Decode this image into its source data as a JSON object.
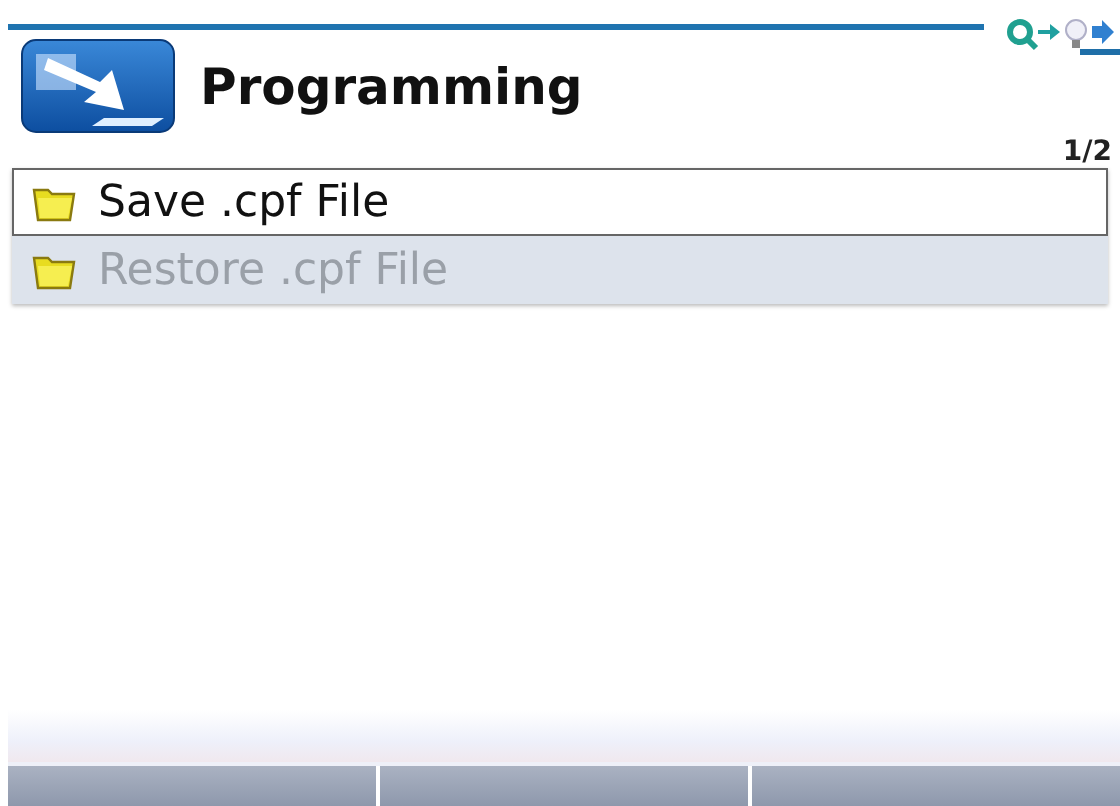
{
  "header": {
    "title": "Programming",
    "page": "1/2"
  },
  "items": [
    {
      "label": "Save .cpf File",
      "selected": true,
      "disabled": false
    },
    {
      "label": "Restore .cpf File",
      "selected": false,
      "disabled": true
    }
  ]
}
